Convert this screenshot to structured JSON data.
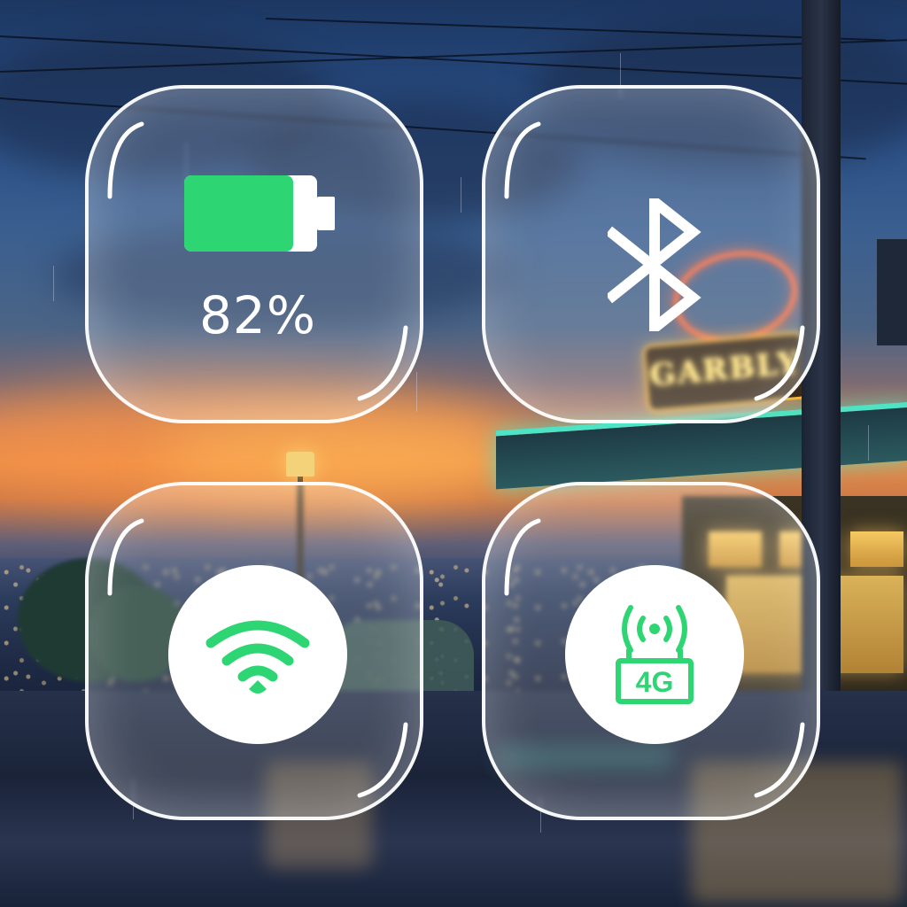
{
  "background": {
    "neon_sign_text": "GARBLY"
  },
  "tiles": {
    "battery": {
      "icon": "battery-icon",
      "level": 0.82,
      "label": "82%",
      "fill_color": "#2ed573"
    },
    "bluetooth": {
      "icon": "bluetooth-icon"
    },
    "wifi": {
      "icon": "wifi-icon",
      "active": true,
      "color": "#2ed573"
    },
    "cellular": {
      "icon": "cellular-4g-icon",
      "network_label": "4G",
      "active": true,
      "color": "#2ed573"
    }
  }
}
